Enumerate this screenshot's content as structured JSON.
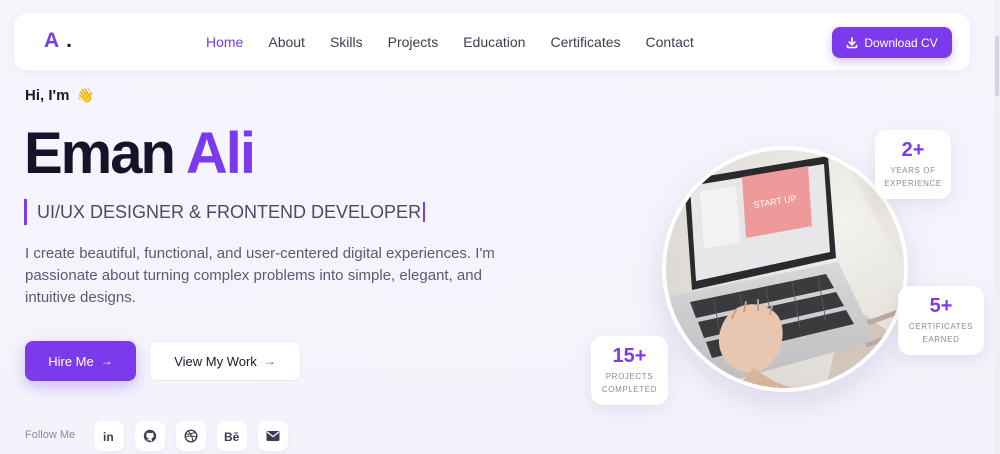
{
  "nav": {
    "logo_letter": "A",
    "logo_dot": ".",
    "links": [
      "Home",
      "About",
      "Skills",
      "Projects",
      "Education",
      "Certificates",
      "Contact"
    ],
    "active_link": "Home",
    "download_label": "Download CV"
  },
  "hero": {
    "greeting": "Hi, I'm",
    "greeting_emoji": "👋",
    "first_name": "Eman",
    "last_name": "Ali",
    "role": "UI/UX DESIGNER & FRONTEND DEVELOPER",
    "description": "I create beautiful, functional, and user-centered digital experiences. I'm passionate about turning complex problems into simple, elegant, and intuitive designs.",
    "hire_label": "Hire Me",
    "work_label": "View My Work",
    "arrow": "→",
    "follow_label": "Follow Me",
    "socials": [
      "linkedin-icon",
      "github-icon",
      "dribbble-icon",
      "behance-icon",
      "mail-icon"
    ]
  },
  "stats": {
    "years": {
      "value": "2+",
      "label_line1": "YEARS OF",
      "label_line2": "EXPERIENCE"
    },
    "certificates": {
      "value": "5+",
      "label_line1": "CERTIFICATES",
      "label_line2": "EARNED"
    },
    "projects": {
      "value": "15+",
      "label_line1": "PROJECTS",
      "label_line2": "COMPLETED"
    }
  },
  "colors": {
    "accent": "#7c3aed",
    "background": "#f6f5fc",
    "heading": "#141428"
  }
}
